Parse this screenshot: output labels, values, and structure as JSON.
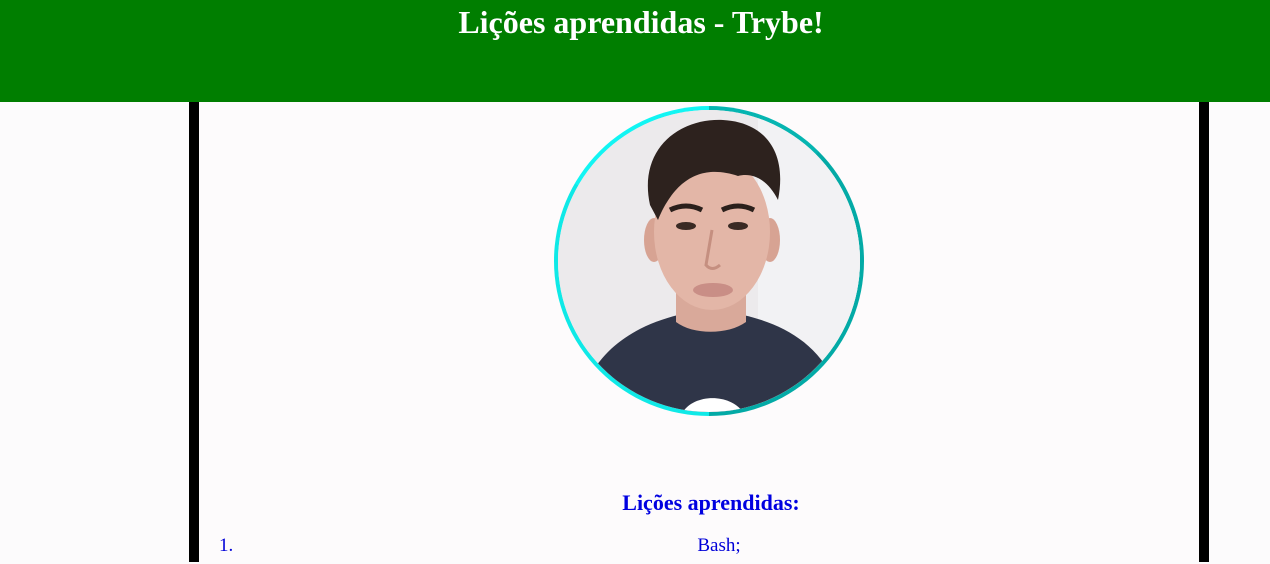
{
  "header": {
    "title": "Lições aprendidas - Trybe!"
  },
  "profile": {
    "photo_icon": "profile-photo",
    "ring_color": "#12f5f3"
  },
  "lessons": {
    "title": "Lições aprendidas:",
    "items": [
      {
        "number": "1.",
        "label": "Bash;"
      }
    ]
  },
  "colors": {
    "header_bg": "#007e00",
    "header_text": "#ffffff",
    "accent_text": "#0000e0",
    "border": "#000000"
  }
}
